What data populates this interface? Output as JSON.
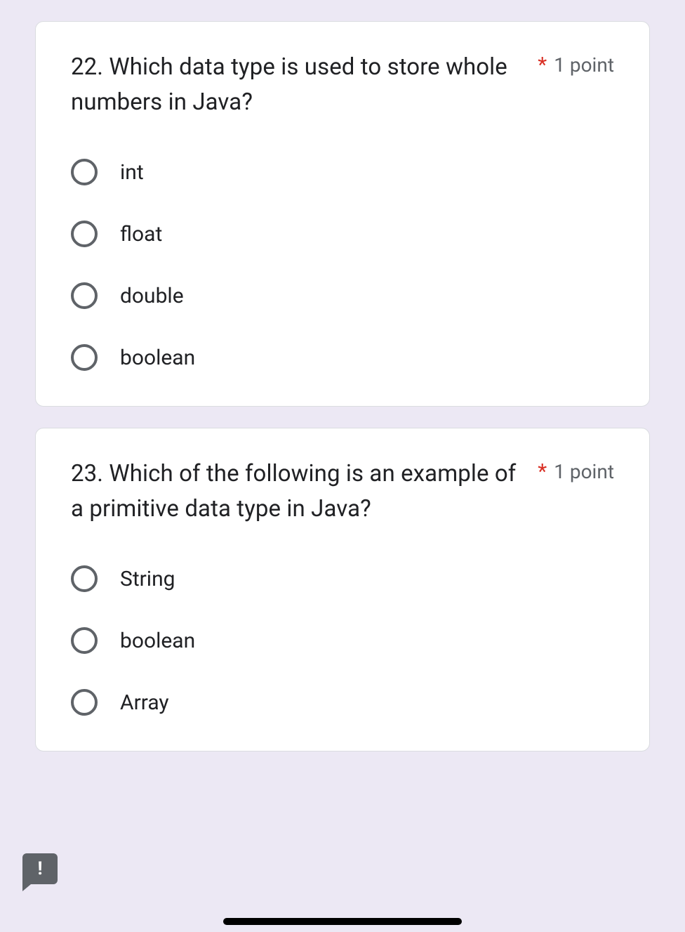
{
  "questions": [
    {
      "number": "22.",
      "text": "Which data type is used to store whole numbers in Java?",
      "required_mark": "*",
      "points": "1 point",
      "options": [
        "int",
        "float",
        "double",
        "boolean"
      ]
    },
    {
      "number": "23.",
      "text": "Which of the following is an example of a primitive data type in Java?",
      "required_mark": "*",
      "points": "1 point",
      "options": [
        "String",
        "boolean",
        "Array"
      ]
    }
  ],
  "report_icon": "!"
}
